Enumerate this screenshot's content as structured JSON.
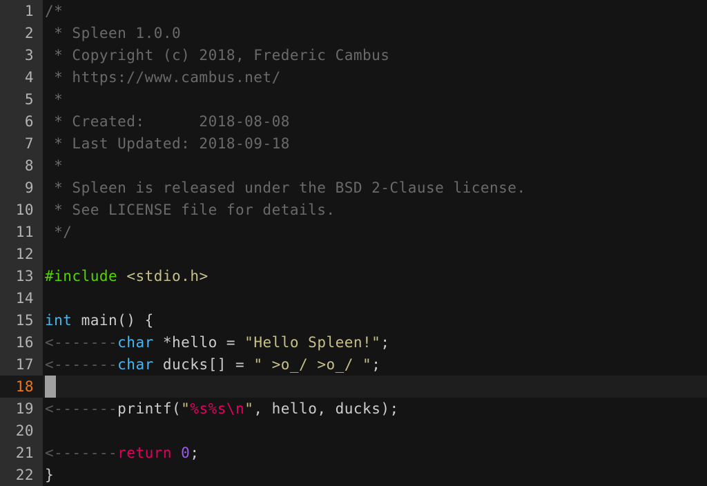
{
  "app": {
    "name": "vim",
    "colors": {
      "background": "#141414",
      "gutter_background": "#2d2d2d",
      "cursorline_background": "#1e1e1e",
      "line_number": "#b4b4b4",
      "current_line_number": "#f07818",
      "cursor_block": "#a0a0a0",
      "comment": "#6a6a6a",
      "preprocessor": "#55d400",
      "include_path": "#c8c08a",
      "type_keyword": "#45b8f0",
      "plain_text": "#cdcdcd",
      "string": "#c8c08a",
      "format_specifier": "#e0005f",
      "statement_keyword": "#e0005f",
      "number": "#9a5ce8",
      "tab_indicator": "#5a5a5a"
    },
    "font_name": "Spleen 1.0.0",
    "tab_indicator_text": "<-------",
    "cursor_line_number": 18,
    "cursor_column": 1,
    "total_lines": 22
  },
  "lines": [
    {
      "number": "1",
      "tokens": [
        {
          "cls": "t-comment",
          "text": "/*"
        }
      ]
    },
    {
      "number": "2",
      "tokens": [
        {
          "cls": "t-comment",
          "text": " * Spleen 1.0.0"
        }
      ]
    },
    {
      "number": "3",
      "tokens": [
        {
          "cls": "t-comment",
          "text": " * Copyright (c) 2018, Frederic Cambus"
        }
      ]
    },
    {
      "number": "4",
      "tokens": [
        {
          "cls": "t-comment",
          "text": " * https://www.cambus.net/"
        }
      ]
    },
    {
      "number": "5",
      "tokens": [
        {
          "cls": "t-comment",
          "text": " *"
        }
      ]
    },
    {
      "number": "6",
      "tokens": [
        {
          "cls": "t-comment",
          "text": " * Created:      2018-08-08"
        }
      ]
    },
    {
      "number": "7",
      "tokens": [
        {
          "cls": "t-comment",
          "text": " * Last Updated: 2018-09-18"
        }
      ]
    },
    {
      "number": "8",
      "tokens": [
        {
          "cls": "t-comment",
          "text": " *"
        }
      ]
    },
    {
      "number": "9",
      "tokens": [
        {
          "cls": "t-comment",
          "text": " * Spleen is released under the BSD 2-Clause license."
        }
      ]
    },
    {
      "number": "10",
      "tokens": [
        {
          "cls": "t-comment",
          "text": " * See LICENSE file for details."
        }
      ]
    },
    {
      "number": "11",
      "tokens": [
        {
          "cls": "t-comment",
          "text": " */"
        }
      ]
    },
    {
      "number": "12",
      "tokens": []
    },
    {
      "number": "13",
      "tokens": [
        {
          "cls": "t-pre",
          "text": "#include"
        },
        {
          "cls": "t-plain",
          "text": " "
        },
        {
          "cls": "t-include",
          "text": "<stdio.h>"
        }
      ]
    },
    {
      "number": "14",
      "tokens": []
    },
    {
      "number": "15",
      "tokens": [
        {
          "cls": "t-type",
          "text": "int"
        },
        {
          "cls": "t-plain",
          "text": " main() {"
        }
      ]
    },
    {
      "number": "16",
      "tokens": [
        {
          "cls": "t-tab",
          "text": "<-------"
        },
        {
          "cls": "t-type",
          "text": "char"
        },
        {
          "cls": "t-plain",
          "text": " *hello = "
        },
        {
          "cls": "t-string",
          "text": "\"Hello Spleen!\""
        },
        {
          "cls": "t-plain",
          "text": ";"
        }
      ]
    },
    {
      "number": "17",
      "tokens": [
        {
          "cls": "t-tab",
          "text": "<-------"
        },
        {
          "cls": "t-type",
          "text": "char"
        },
        {
          "cls": "t-plain",
          "text": " ducks[] = "
        },
        {
          "cls": "t-string",
          "text": "\" >o_/ >o_/ \""
        },
        {
          "cls": "t-plain",
          "text": ";"
        }
      ]
    },
    {
      "number": "18",
      "tokens": [],
      "current": true
    },
    {
      "number": "19",
      "tokens": [
        {
          "cls": "t-tab",
          "text": "<-------"
        },
        {
          "cls": "t-plain",
          "text": "printf("
        },
        {
          "cls": "t-string",
          "text": "\""
        },
        {
          "cls": "t-fmt",
          "text": "%s%s\\n"
        },
        {
          "cls": "t-string",
          "text": "\""
        },
        {
          "cls": "t-plain",
          "text": ", hello, ducks);"
        }
      ]
    },
    {
      "number": "20",
      "tokens": []
    },
    {
      "number": "21",
      "tokens": [
        {
          "cls": "t-tab",
          "text": "<-------"
        },
        {
          "cls": "t-kw",
          "text": "return"
        },
        {
          "cls": "t-plain",
          "text": " "
        },
        {
          "cls": "t-num",
          "text": "0"
        },
        {
          "cls": "t-plain",
          "text": ";"
        }
      ]
    },
    {
      "number": "22",
      "tokens": [
        {
          "cls": "t-plain",
          "text": "}"
        }
      ]
    }
  ]
}
